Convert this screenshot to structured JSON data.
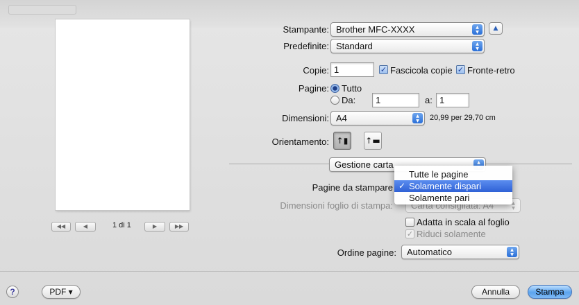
{
  "preview": {
    "page_counter": "1 di 1",
    "nav_first": "◀◀",
    "nav_prev": "◀",
    "nav_next": "▶",
    "nav_last": "▶▶"
  },
  "printer": {
    "label": "Stampante:",
    "value": "Brother MFC-XXXX",
    "disclose": "▲"
  },
  "presets": {
    "label": "Predefinite:",
    "value": "Standard"
  },
  "copies": {
    "label": "Copie:",
    "value": "1",
    "collate_label": "Fascicola copie",
    "collate_checked": true,
    "duplex_label": "Fronte-retro",
    "duplex_checked": true
  },
  "pages": {
    "label": "Pagine:",
    "all_label": "Tutto",
    "from_label": "Da:",
    "from_value": "1",
    "to_label": "a:",
    "to_value": "1",
    "selected": "all"
  },
  "paper_size": {
    "label": "Dimensioni:",
    "value": "A4",
    "dimensions_text": "20,99 per 29,70 cm"
  },
  "orientation": {
    "label": "Orientamento:",
    "portrait_icon": "portrait-orientation-icon",
    "landscape_icon": "landscape-orientation-icon",
    "selected": "portrait"
  },
  "panel": {
    "value": "Gestione carta"
  },
  "paper_handling": {
    "pages_to_print_label": "Pagine da stampare",
    "pages_to_print_options": [
      "Tutte le pagine",
      "Solamente dispari",
      "Solamente pari"
    ],
    "pages_to_print_selected": "Solamente dispari",
    "dest_paper_label": "Dimensioni foglio di stampa:",
    "dest_paper_value": "Carta consigliata: A4",
    "scale_to_fit_label": "Adatta in scala al foglio",
    "scale_to_fit_checked": false,
    "scale_down_only_label": "Riduci solamente",
    "scale_down_only_checked": true,
    "page_order_label": "Ordine pagine:",
    "page_order_value": "Automatico"
  },
  "footer": {
    "help": "?",
    "pdf": "PDF ▾",
    "cancel": "Annulla",
    "print": "Stampa"
  },
  "colors": {
    "accent": "#2f61d6",
    "default_button": "#5aa3ee"
  }
}
